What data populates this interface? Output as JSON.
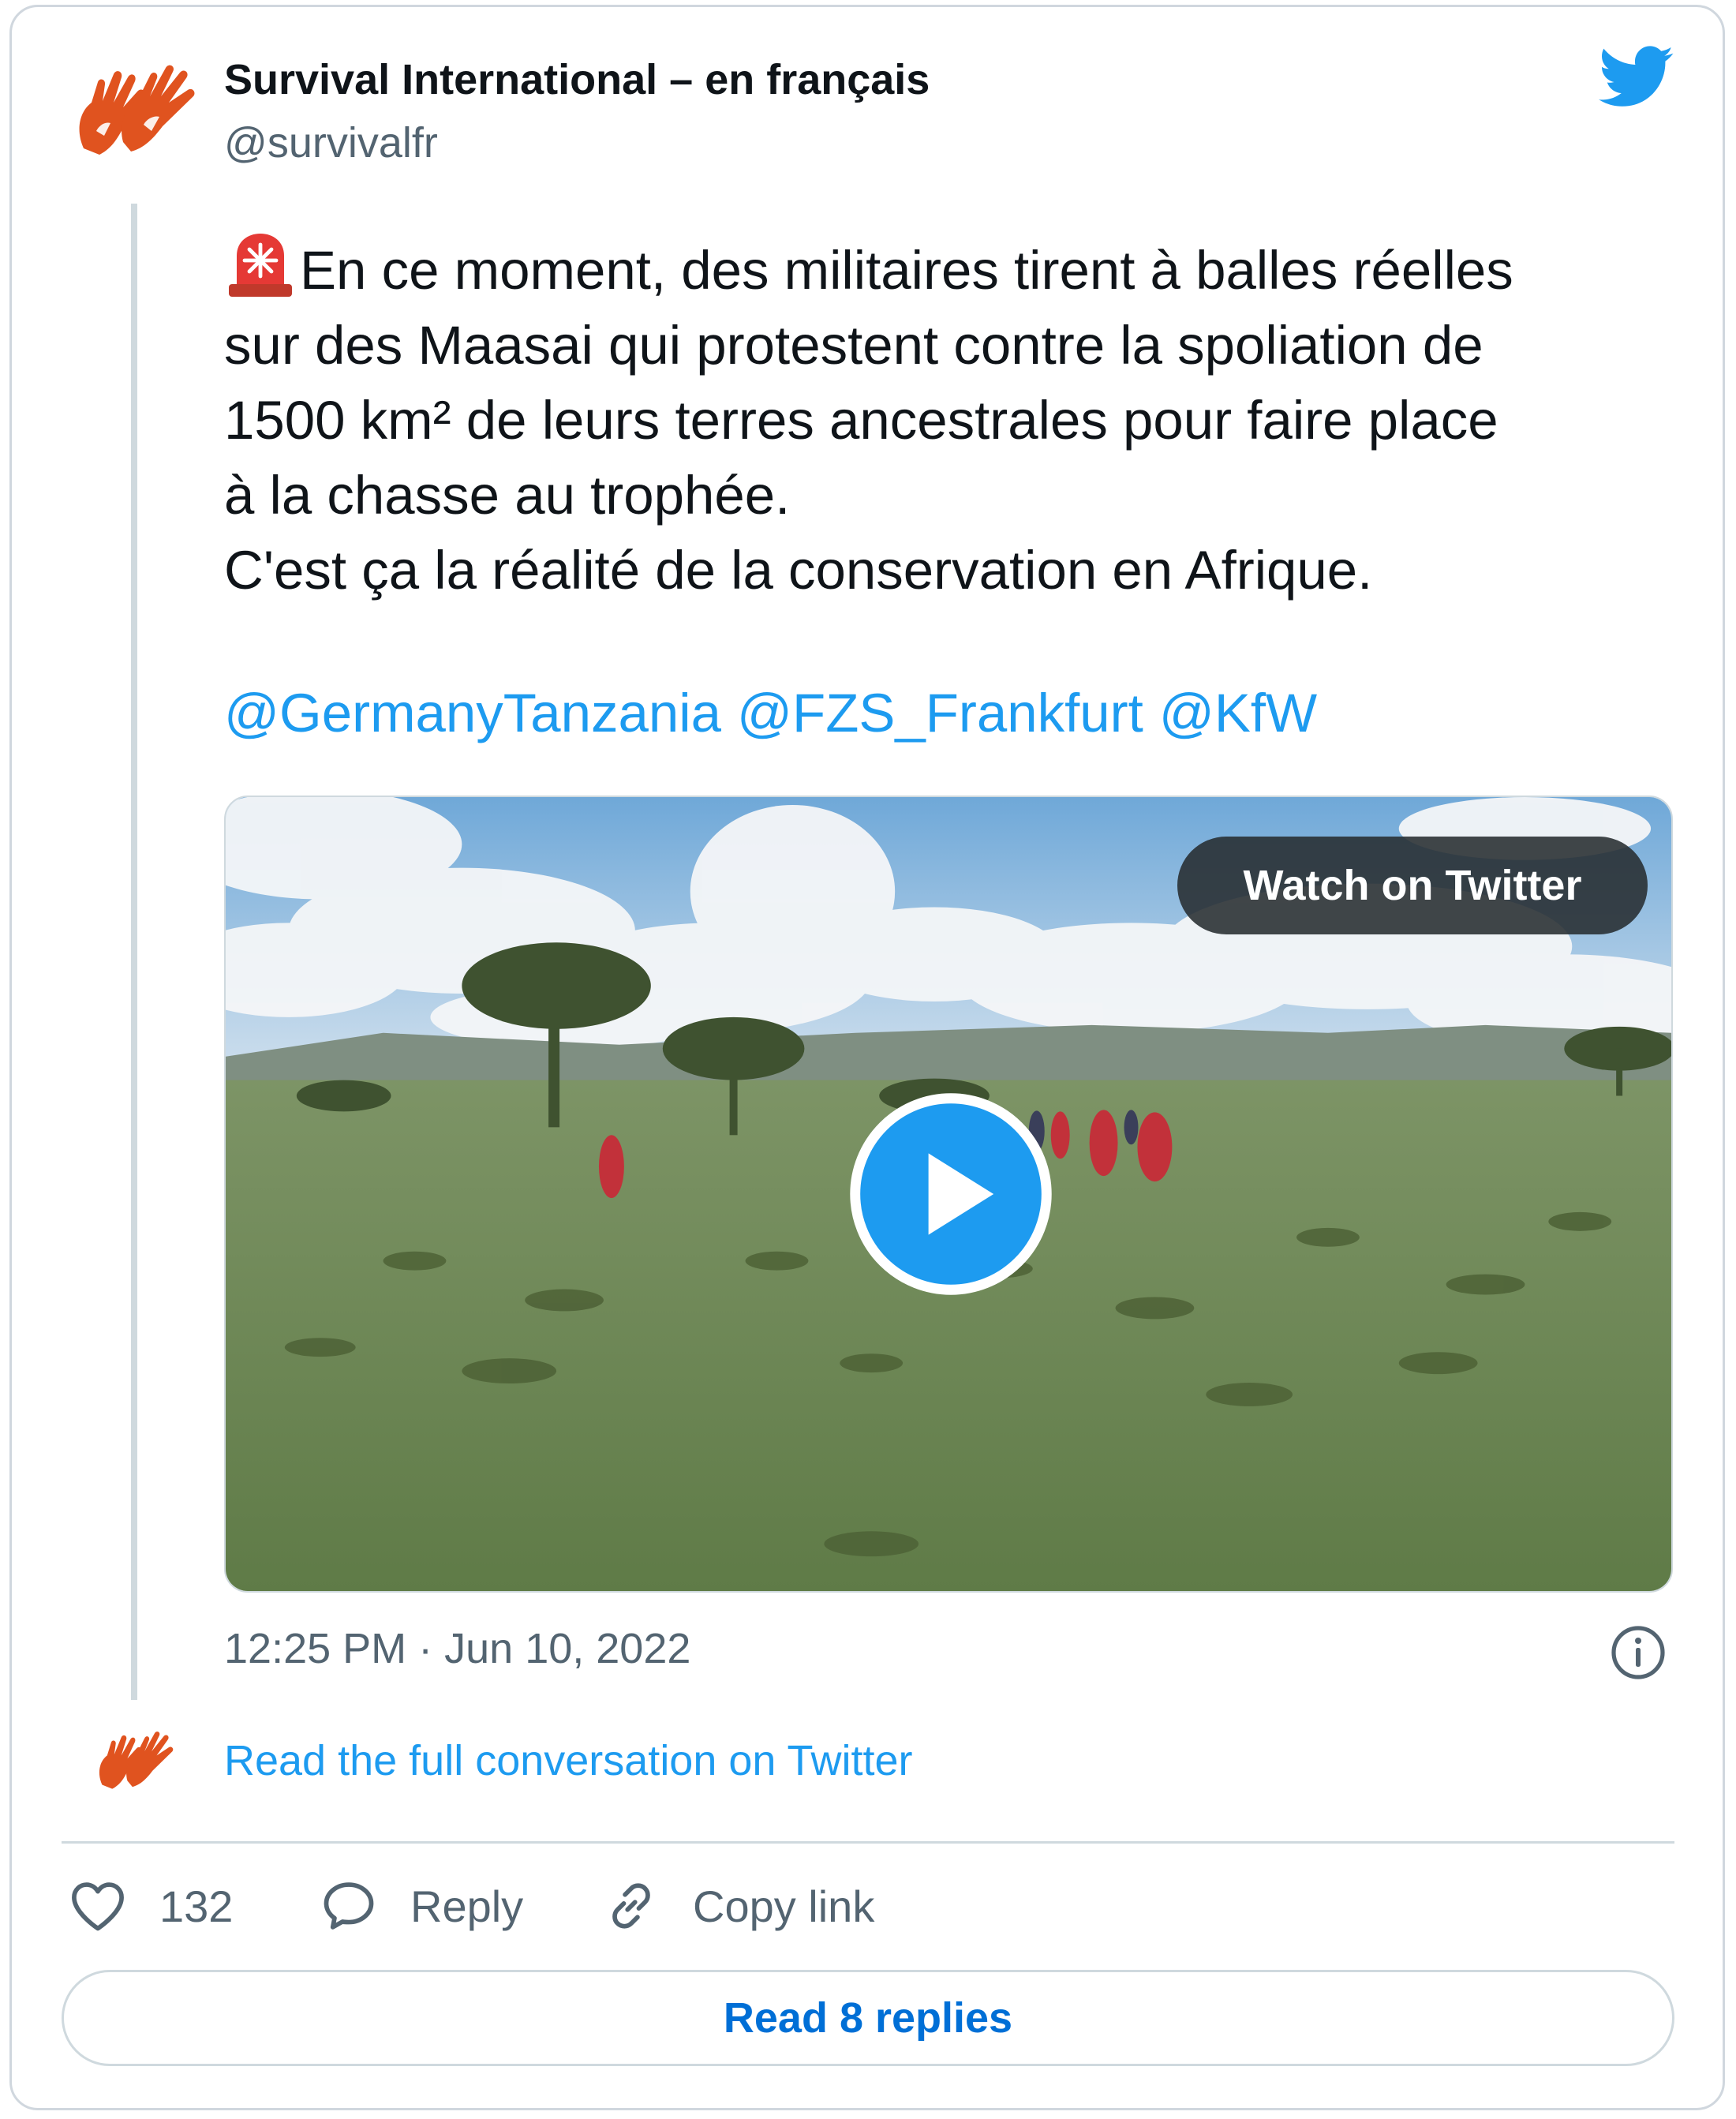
{
  "colors": {
    "link_blue": "#1d9bf0",
    "brand_orange": "#e0531f",
    "text_primary": "#0f1419",
    "text_secondary": "#536471",
    "border": "#cfd9de"
  },
  "author": {
    "name": "Survival International – en français",
    "handle": "@survivalfr",
    "avatar_icon": "survival-hands-logo-icon",
    "platform_icon": "twitter-bird-icon"
  },
  "tweet": {
    "text_lines": [
      "En ce moment, des militaires tirent à balles réelles",
      "sur des Maasai qui protestent contre la spoliation de",
      "1500 km² de leurs terres ancestrales pour faire place",
      "à la chasse au trophée.",
      "C'est ça la réalité de la conservation en Afrique."
    ],
    "leading_emoji": "rotating-light-icon",
    "mentions": [
      "@GermanyTanzania",
      "@FZS_Frankfurt",
      "@KfW"
    ],
    "timestamp": "12:25 PM · Jun 10, 2022"
  },
  "media": {
    "watch_label": "Watch on Twitter",
    "play_icon": "play-icon"
  },
  "conversation": {
    "label": "Read the full conversation on Twitter"
  },
  "actions": {
    "likes": "132",
    "reply_label": "Reply",
    "copy_label": "Copy link"
  },
  "footer": {
    "read_replies_label": "Read 8 replies"
  }
}
